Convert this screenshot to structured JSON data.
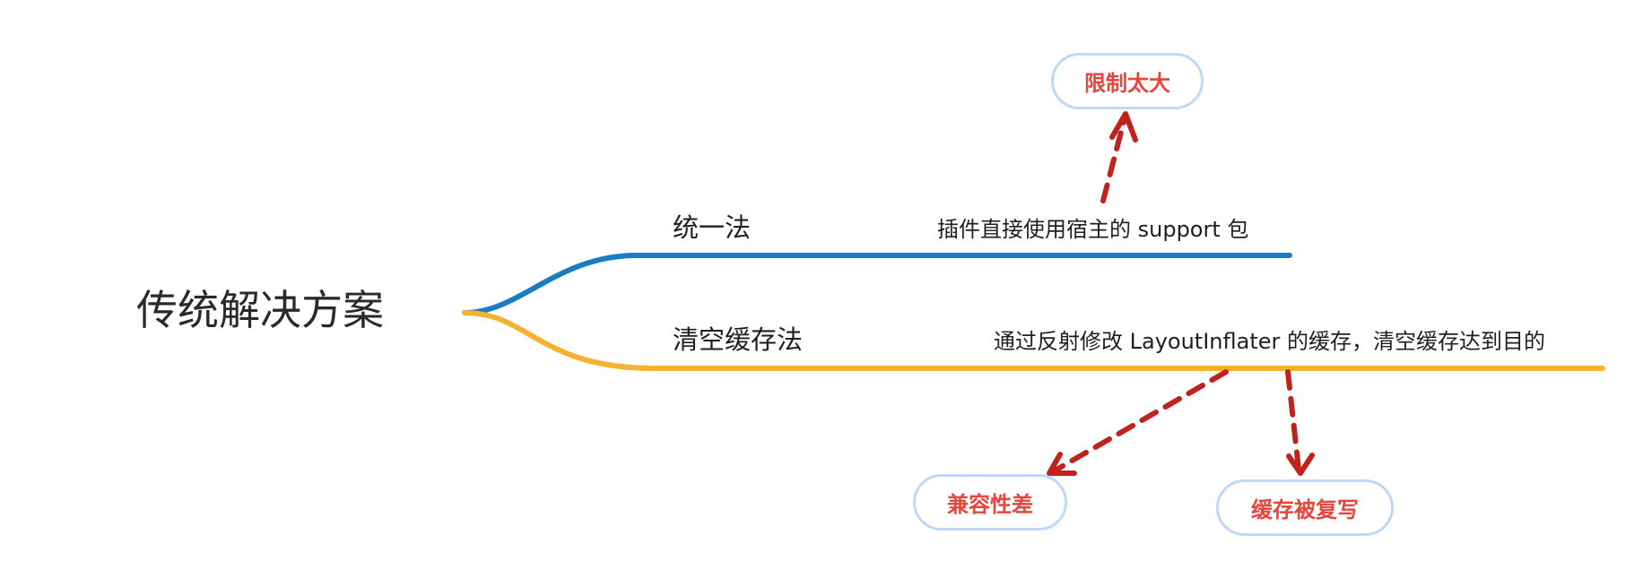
{
  "diagram": {
    "root": "传统解决方案",
    "branches": [
      {
        "label": "统一法",
        "detail": "插件直接使用宿主的 support 包",
        "color": "#1a7dc4"
      },
      {
        "label": "清空缓存法",
        "detail": "通过反射修改 LayoutInflater 的缓存，清空缓存达到目的",
        "color": "#f5b230"
      }
    ],
    "notes": [
      "限制太大",
      "兼容性差",
      "缓存被复写"
    ],
    "note_text_color": "#e8453c",
    "note_border_color": "#bcd9f7",
    "arrow_color": "#c0221c"
  }
}
